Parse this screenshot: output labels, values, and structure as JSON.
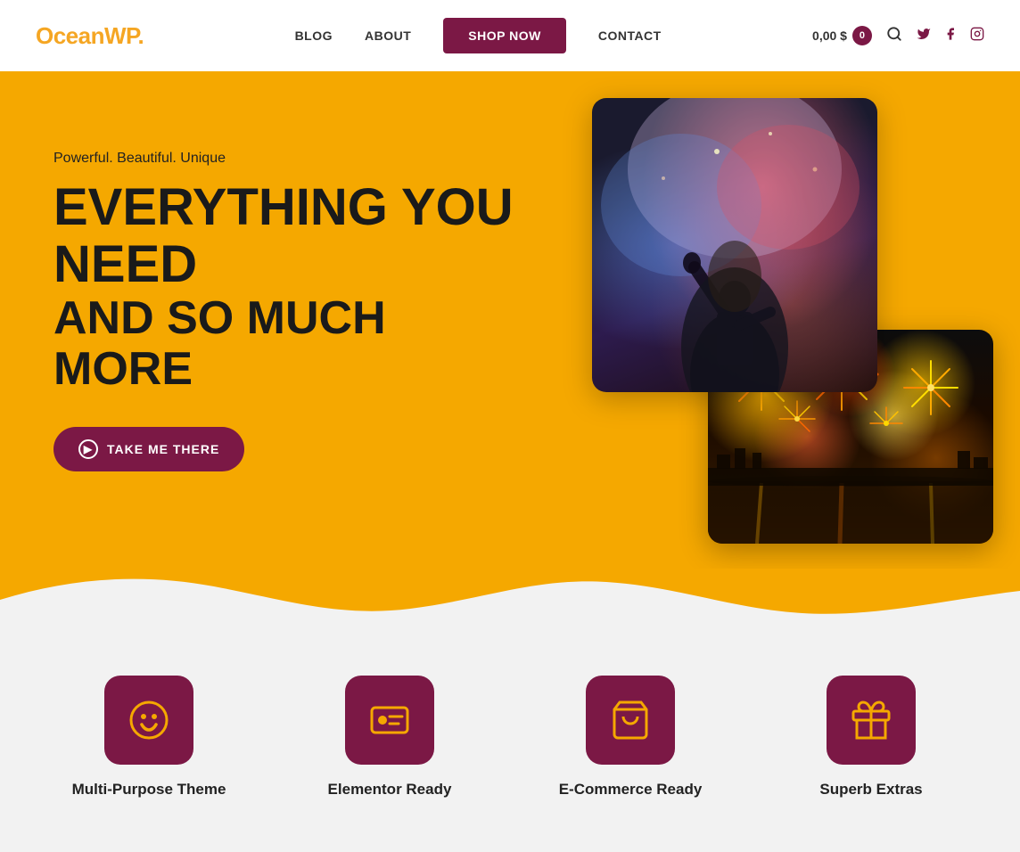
{
  "header": {
    "logo_text": "OceanWP",
    "logo_dot": ".",
    "nav": {
      "blog": "BLOG",
      "about": "ABOUT",
      "shop_now": "SHOP NOW",
      "contact": "CONTACT"
    },
    "cart": {
      "price": "0,00 $",
      "count": "0"
    },
    "social": {
      "twitter": "twitter-icon",
      "facebook": "facebook-icon",
      "instagram": "instagram-icon"
    }
  },
  "hero": {
    "subtitle": "Powerful. Beautiful. Unique",
    "title_line1": "EVERYTHING YOU NEED",
    "title_line2": "AND SO MUCH MORE",
    "cta_button": "TAKE ME THERE"
  },
  "features": {
    "items": [
      {
        "id": "multi-purpose",
        "label": "Multi-Purpose Theme",
        "icon": "smiley"
      },
      {
        "id": "elementor",
        "label": "Elementor Ready",
        "icon": "id-card"
      },
      {
        "id": "ecommerce",
        "label": "E-Commerce Ready",
        "icon": "cart"
      },
      {
        "id": "extras",
        "label": "Superb Extras",
        "icon": "gift"
      }
    ]
  },
  "colors": {
    "brand_purple": "#7b1845",
    "brand_yellow": "#f5a800",
    "bg_light": "#f2f2f2"
  }
}
